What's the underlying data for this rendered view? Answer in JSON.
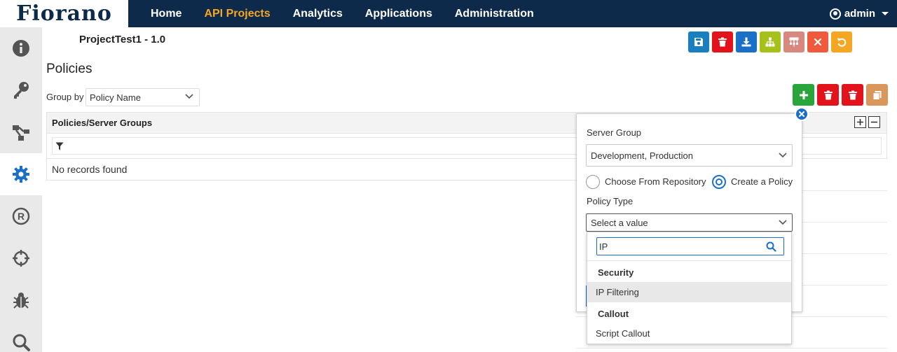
{
  "brand": {
    "logo_text": "Fiorano"
  },
  "nav": {
    "items": [
      {
        "label": "Home"
      },
      {
        "label": "API Projects"
      },
      {
        "label": "Analytics"
      },
      {
        "label": "Applications"
      },
      {
        "label": "Administration"
      }
    ],
    "active": "API Projects",
    "user": "admin"
  },
  "sidebar": {
    "items": [
      {
        "icon": "info-icon"
      },
      {
        "icon": "key-icon"
      },
      {
        "icon": "flow-icon"
      },
      {
        "icon": "gear-icon",
        "active": true
      },
      {
        "icon": "registered-icon"
      },
      {
        "icon": "crosshair-icon"
      },
      {
        "icon": "bug-icon"
      },
      {
        "icon": "search-icon"
      }
    ]
  },
  "project": {
    "title": "ProjectTest1 - 1.0"
  },
  "toolbar": {
    "buttons": [
      {
        "icon": "save-icon",
        "color": "#1a7fc1"
      },
      {
        "icon": "trash-icon",
        "color": "#e3131b"
      },
      {
        "icon": "download-icon",
        "color": "#1a6fc7"
      },
      {
        "icon": "hierarchy-icon",
        "color": "#a6c21a"
      },
      {
        "icon": "network-icon",
        "color": "#d98880"
      },
      {
        "icon": "close-icon",
        "color": "#f05a3c"
      },
      {
        "icon": "undo-icon",
        "color": "#f5a623"
      }
    ]
  },
  "page": {
    "heading": "Policies",
    "group_by_label": "Group by",
    "group_by_value": "Policy Name"
  },
  "grid": {
    "column_header": "Policies/Server Groups",
    "empty_text": "No records found"
  },
  "right_tools": [
    {
      "icon": "plus-icon",
      "color": "#2aa53c"
    },
    {
      "icon": "trash-icon",
      "color": "#e3131b"
    },
    {
      "icon": "trash-icon",
      "color": "#e3131b"
    },
    {
      "icon": "copy-icon",
      "color": "#d9975b"
    }
  ],
  "popup": {
    "server_group_label": "Server Group",
    "server_group_value": "Development, Production",
    "radio_repo_label": "Choose From Repository",
    "radio_create_label": "Create a Policy",
    "radio_selected": "Create a Policy",
    "policy_type_label": "Policy Type",
    "policy_type_value": "Select a value"
  },
  "dropdown": {
    "search_value": "IP",
    "groups": [
      {
        "name": "Security",
        "items": [
          "IP Filtering"
        ]
      },
      {
        "name": "Callout",
        "items": [
          "Script Callout"
        ]
      }
    ],
    "highlighted": "IP Filtering"
  },
  "colors": {
    "nav_bg": "#0d2a4a",
    "accent_orange": "#f5a623",
    "primary_blue": "#1a6fc7"
  }
}
